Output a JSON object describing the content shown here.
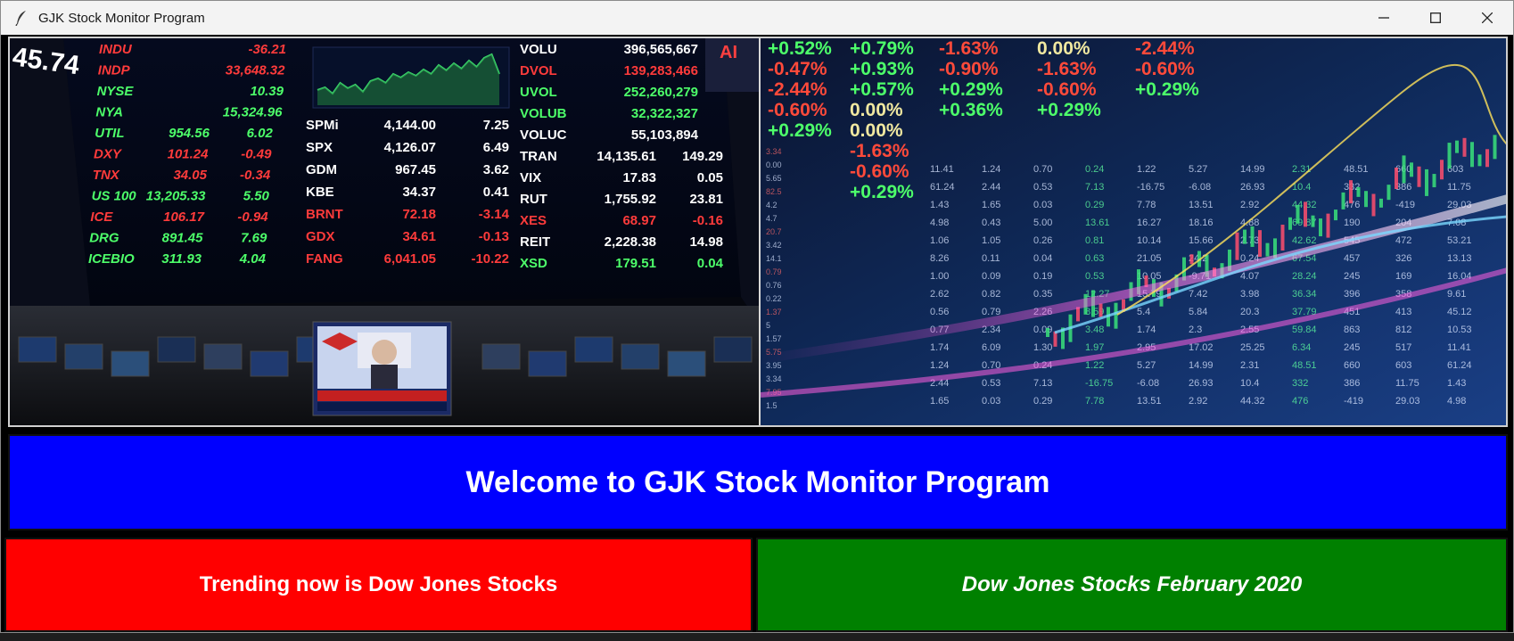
{
  "window": {
    "title": "GJK Stock Monitor Program",
    "app_icon": "feather-icon",
    "controls": [
      "minimize-icon",
      "maximize-icon",
      "close-icon"
    ]
  },
  "banner": {
    "left_ticker": [
      {
        "sym": "INDU",
        "a": "-36.21",
        "b": "",
        "c": "",
        "color": "#ff3b3b"
      },
      {
        "sym": "INDP",
        "a": "33,648.32",
        "b": "",
        "c": "",
        "color": "#ff3b3b"
      },
      {
        "sym": "NYSE",
        "a": "10.39",
        "b": "",
        "c": "",
        "color": "#4dff6a"
      },
      {
        "sym": "NYA",
        "a": "15,324.96",
        "b": "",
        "c": "",
        "color": "#4dff6a"
      },
      {
        "sym": "UTIL",
        "a": "954.56",
        "b": "6.02",
        "c": "",
        "color": "#4dff6a"
      },
      {
        "sym": "DXY",
        "a": "101.24",
        "b": "-0.49",
        "c": "",
        "color": "#ff3b3b"
      },
      {
        "sym": "TNX",
        "a": "34.05",
        "b": "-0.34",
        "c": "",
        "color": "#ff3b3b"
      },
      {
        "sym": "US 100",
        "a": "13,205.33",
        "b": "5.50",
        "c": "",
        "color": "#4dff6a"
      },
      {
        "sym": "ICE",
        "a": "106.17",
        "b": "-0.94",
        "c": "",
        "color": "#ff3b3b"
      },
      {
        "sym": "DRG",
        "a": "891.45",
        "b": "7.69",
        "c": "",
        "color": "#4dff6a"
      },
      {
        "sym": "ICEBIO",
        "a": "311.93",
        "b": "4.04",
        "c": "",
        "color": "#4dff6a"
      }
    ],
    "mid_ticker": [
      {
        "sym": "SPMi",
        "a": "4,144.00",
        "b": "7.25",
        "color": "#ffffff"
      },
      {
        "sym": "SPX",
        "a": "4,126.07",
        "b": "6.49",
        "color": "#ffffff"
      },
      {
        "sym": "GDM",
        "a": "967.45",
        "b": "3.62",
        "color": "#ffffff"
      },
      {
        "sym": "KBE",
        "a": "34.37",
        "b": "0.41",
        "color": "#ffffff"
      },
      {
        "sym": "BRNT",
        "a": "72.18",
        "b": "-3.14",
        "color": "#ff3b3b"
      },
      {
        "sym": "GDX",
        "a": "34.61",
        "b": "-0.13",
        "color": "#ff3b3b"
      },
      {
        "sym": "FANG",
        "a": "6,041.05",
        "b": "-10.22",
        "color": "#ff3b3b"
      }
    ],
    "right_ticker": [
      {
        "sym": "VOLU",
        "a": "396,565,667",
        "b": "",
        "color": "#ffffff"
      },
      {
        "sym": "DVOL",
        "a": "139,283,466",
        "b": "",
        "color": "#ff3b3b"
      },
      {
        "sym": "UVOL",
        "a": "252,260,279",
        "b": "",
        "color": "#4dff6a"
      },
      {
        "sym": "VOLUB",
        "a": "32,322,327",
        "b": "",
        "color": "#4dff6a"
      },
      {
        "sym": "VOLUC",
        "a": "55,103,894",
        "b": "",
        "color": "#ffffff"
      },
      {
        "sym": "TRAN",
        "a": "14,135.61",
        "b": "149.29",
        "color": "#ffffff"
      },
      {
        "sym": "VIX",
        "a": "17.83",
        "b": "0.05",
        "color": "#ffffff"
      },
      {
        "sym": "RUT",
        "a": "1,755.92",
        "b": "23.81",
        "color": "#ffffff"
      },
      {
        "sym": "XES",
        "a": "68.97",
        "b": "-0.16",
        "color": "#ff3b3b"
      },
      {
        "sym": "REIT",
        "a": "2,228.38",
        "b": "14.98",
        "color": "#ffffff"
      },
      {
        "sym": "XSD",
        "a": "179.51",
        "b": "0.04",
        "color": "#4dff6a"
      }
    ],
    "percents": [
      {
        "t": "+0.52%",
        "c": "#4dff6a"
      },
      {
        "t": "+0.79%",
        "c": "#4dff6a"
      },
      {
        "t": "-1.63%",
        "c": "#ff4a3a"
      },
      {
        "t": "0.00%",
        "c": "#f0e8a0"
      },
      {
        "t": "-2.44%",
        "c": "#ff4a3a"
      },
      {
        "t": "-0.47%",
        "c": "#ff4a3a"
      },
      {
        "t": "+0.93%",
        "c": "#4dff6a"
      },
      {
        "t": "-0.90%",
        "c": "#ff4a3a"
      },
      {
        "t": "-1.63%",
        "c": "#ff4a3a"
      },
      {
        "t": "-0.60%",
        "c": "#ff4a3a"
      },
      {
        "t": "-2.44%",
        "c": "#ff4a3a"
      },
      {
        "t": "+0.57%",
        "c": "#4dff6a"
      },
      {
        "t": "+0.29%",
        "c": "#4dff6a"
      },
      {
        "t": "-0.60%",
        "c": "#ff4a3a"
      },
      {
        "t": "+0.29%",
        "c": "#4dff6a"
      },
      {
        "t": "-0.60%",
        "c": "#ff4a3a"
      },
      {
        "t": "0.00%",
        "c": "#f0e8a0"
      },
      {
        "t": "+0.36%",
        "c": "#4dff6a"
      },
      {
        "t": "+0.29%",
        "c": "#4dff6a"
      },
      {
        "t": "",
        "c": "#4dff6a"
      },
      {
        "t": "+0.29%",
        "c": "#4dff6a"
      },
      {
        "t": "0.00%",
        "c": "#f0e8a0"
      },
      {
        "t": "",
        "c": "#4dff6a"
      },
      {
        "t": "",
        "c": "#4dff6a"
      },
      {
        "t": "",
        "c": "#4dff6a"
      },
      {
        "t": "",
        "c": "#4dff6a"
      },
      {
        "t": "-1.63%",
        "c": "#ff4a3a"
      },
      {
        "t": "",
        "c": "#4dff6a"
      },
      {
        "t": "",
        "c": "#4dff6a"
      },
      {
        "t": "",
        "c": "#4dff6a"
      },
      {
        "t": "",
        "c": "#4dff6a"
      },
      {
        "t": "-0.60%",
        "c": "#ff4a3a"
      },
      {
        "t": "",
        "c": "#4dff6a"
      },
      {
        "t": "",
        "c": "#4dff6a"
      },
      {
        "t": "",
        "c": "#4dff6a"
      },
      {
        "t": "",
        "c": "#4dff6a"
      },
      {
        "t": "+0.29%",
        "c": "#4dff6a"
      },
      {
        "t": "",
        "c": "#4dff6a"
      },
      {
        "t": "",
        "c": "#4dff6a"
      },
      {
        "t": "",
        "c": "#4dff6a"
      }
    ]
  },
  "welcome": {
    "text": "Welcome to GJK Stock Monitor Program",
    "bg": "#0000ff"
  },
  "buttons": {
    "trending": {
      "label": "Trending now is Dow Jones Stocks",
      "bg": "#ff0000"
    },
    "february": {
      "label": "Dow Jones Stocks February 2020",
      "bg": "#008000"
    }
  }
}
